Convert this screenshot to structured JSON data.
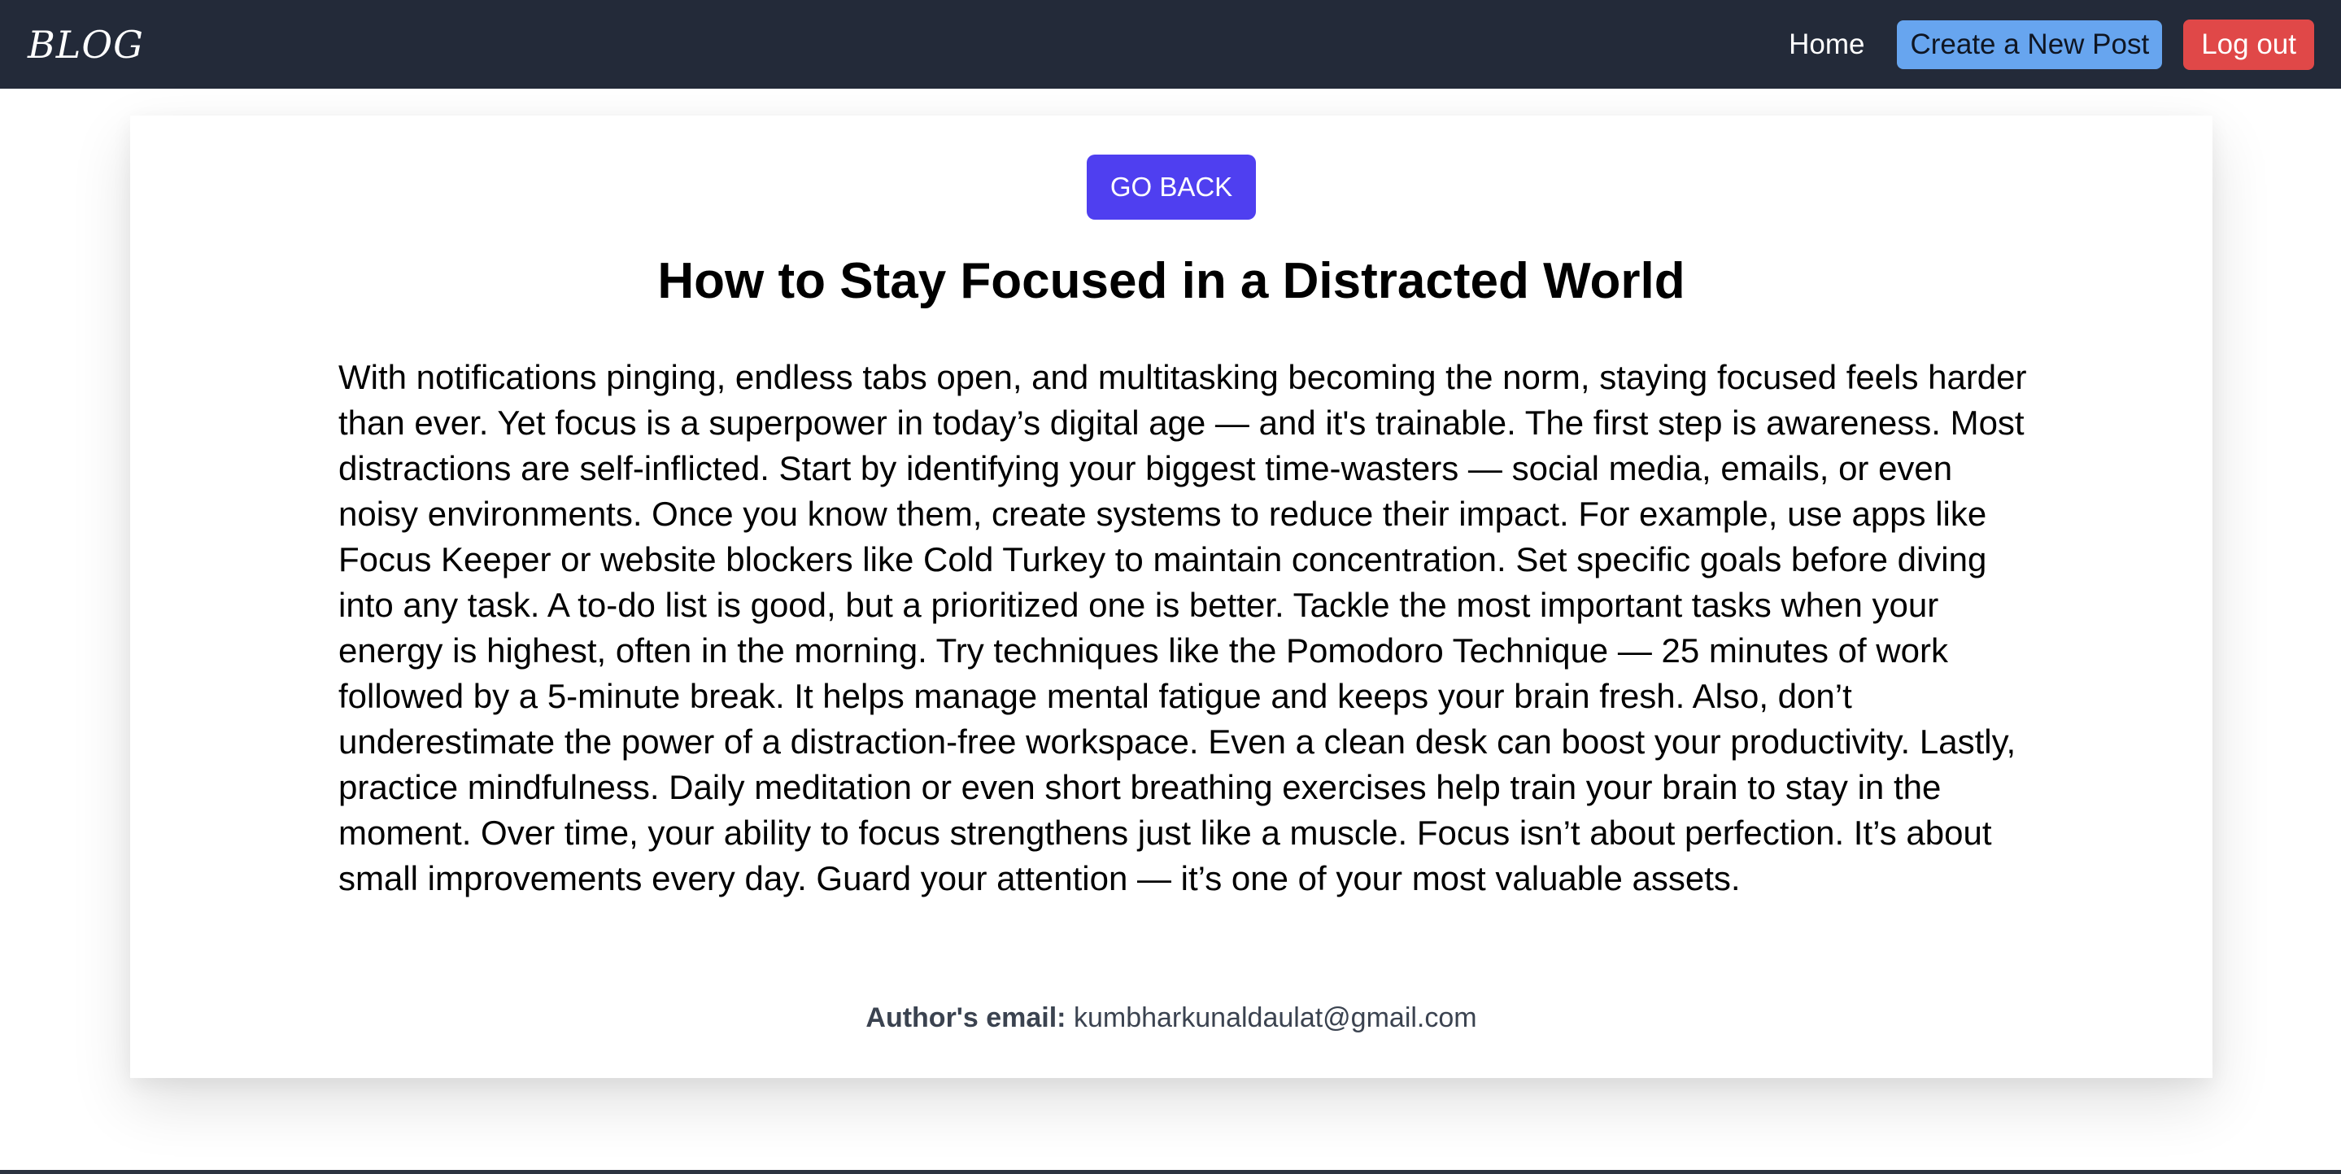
{
  "navbar": {
    "brand": "BLOG",
    "home_label": "Home",
    "create_label": "Create a New Post",
    "logout_label": "Log out"
  },
  "post": {
    "back_label": "GO BACK",
    "title": "How to Stay Focused in a Distracted World",
    "body": "With notifications pinging, endless tabs open, and multitasking becoming the norm, staying focused feels harder than ever. Yet focus is a superpower in today’s digital age — and it's trainable. The first step is awareness. Most distractions are self-inflicted. Start by identifying your biggest time-wasters — social media, emails, or even noisy environments. Once you know them, create systems to reduce their impact. For example, use apps like Focus Keeper or website blockers like Cold Turkey to maintain concentration. Set specific goals before diving into any task. A to-do list is good, but a prioritized one is better. Tackle the most important tasks when your energy is highest, often in the morning. Try techniques like the Pomodoro Technique — 25 minutes of work followed by a 5-minute break. It helps manage mental fatigue and keeps your brain fresh. Also, don’t underestimate the power of a distraction-free workspace. Even a clean desk can boost your productivity. Lastly, practice mindfulness. Daily meditation or even short breathing exercises help train your brain to stay in the moment. Over time, your ability to focus strengthens just like a muscle. Focus isn’t about perfection. It’s about small improvements every day. Guard your attention — it’s one of your most valuable assets.",
    "author_label": "Author's email:",
    "author_email": "kumbharkunaldaulat@gmail.com"
  },
  "colors": {
    "navbar_bg": "#232a39",
    "create_button": "#67a5ef",
    "logout_button": "#e04848",
    "go_back_button": "#4f3ff0"
  }
}
